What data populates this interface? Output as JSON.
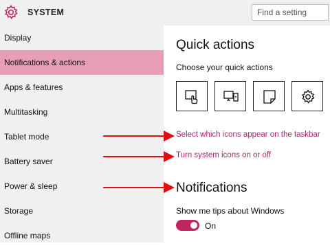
{
  "header": {
    "title": "SYSTEM",
    "search_placeholder": "Find a setting"
  },
  "sidebar": {
    "items": [
      {
        "label": "Display",
        "selected": false
      },
      {
        "label": "Notifications & actions",
        "selected": true
      },
      {
        "label": "Apps & features",
        "selected": false
      },
      {
        "label": "Multitasking",
        "selected": false
      },
      {
        "label": "Tablet mode",
        "selected": false
      },
      {
        "label": "Battery saver",
        "selected": false
      },
      {
        "label": "Power & sleep",
        "selected": false
      },
      {
        "label": "Storage",
        "selected": false
      },
      {
        "label": "Offline maps",
        "selected": false
      }
    ]
  },
  "main": {
    "quick_actions_title": "Quick actions",
    "quick_actions_sub": "Choose your quick actions",
    "quick_action_icons": [
      "tablet-touch-icon",
      "project-icon",
      "note-icon",
      "settings-gear-icon"
    ],
    "link_select_icons": "Select which icons appear on the taskbar",
    "link_system_icons": "Turn system icons on or off",
    "notifications_title": "Notifications",
    "tips_label": "Show me tips about Windows",
    "tips_state": "On",
    "tips_enabled": true
  },
  "colors": {
    "accent": "#c0265f",
    "selected_bg": "#e6a0b6",
    "link": "#b0226a",
    "sidebar_bg": "#f0f0f0",
    "arrow": "#e01010"
  }
}
